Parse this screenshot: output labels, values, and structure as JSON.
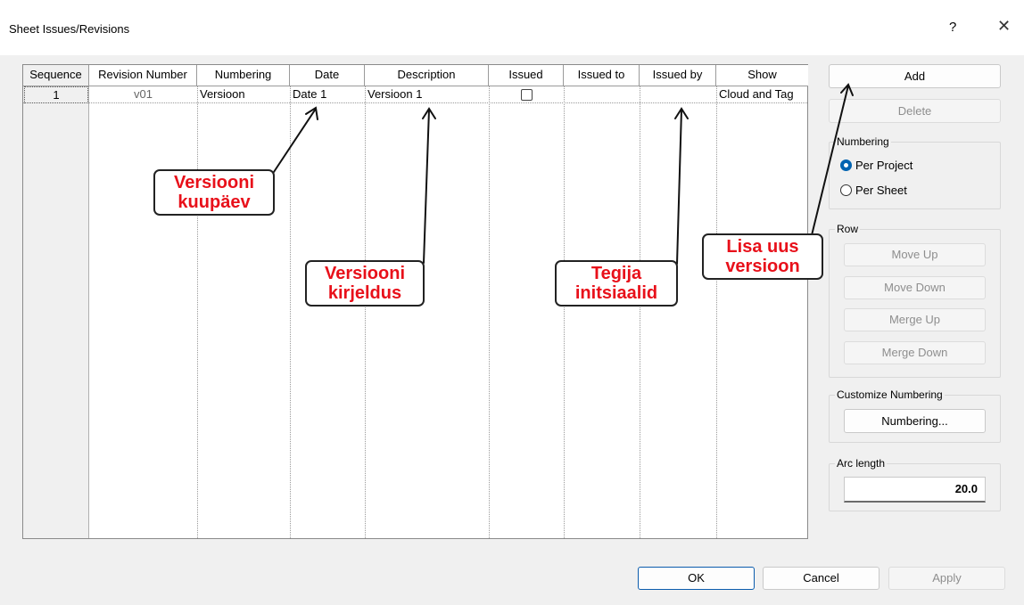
{
  "window": {
    "title": "Sheet Issues/Revisions",
    "help": "?",
    "close": "✕"
  },
  "grid": {
    "headers": [
      "Sequence",
      "Revision Number",
      "Numbering",
      "Date",
      "Description",
      "Issued",
      "Issued to",
      "Issued by",
      "Show"
    ],
    "rows": [
      {
        "sequence": "1",
        "revision_number": "v01",
        "numbering": "Versioon",
        "date": "Date 1",
        "description": "Versioon 1",
        "issued": false,
        "issued_to": "",
        "issued_by": "",
        "show": "Cloud and Tag"
      }
    ]
  },
  "side": {
    "add": "Add",
    "delete": "Delete",
    "numbering_group": "Numbering",
    "per_project": "Per Project",
    "per_sheet": "Per Sheet",
    "row_group": "Row",
    "move_up": "Move Up",
    "move_down": "Move Down",
    "merge_up": "Merge Up",
    "merge_down": "Merge Down",
    "customize_group": "Customize Numbering",
    "numbering_button": "Numbering...",
    "arc_group": "Arc length",
    "arc_value": "20.0"
  },
  "footer": {
    "ok": "OK",
    "cancel": "Cancel",
    "apply": "Apply"
  },
  "annotations": {
    "date_line1": "Versiooni",
    "date_line2": "kuupäev",
    "desc_line1": "Versiooni",
    "desc_line2": "kirjeldus",
    "by_line1": "Tegija",
    "by_line2": "initsiaalid",
    "add_line1": "Lisa uus",
    "add_line2": "versioon"
  },
  "colors": {
    "accent": "#0063b1",
    "annotation_text": "#e8101a"
  }
}
